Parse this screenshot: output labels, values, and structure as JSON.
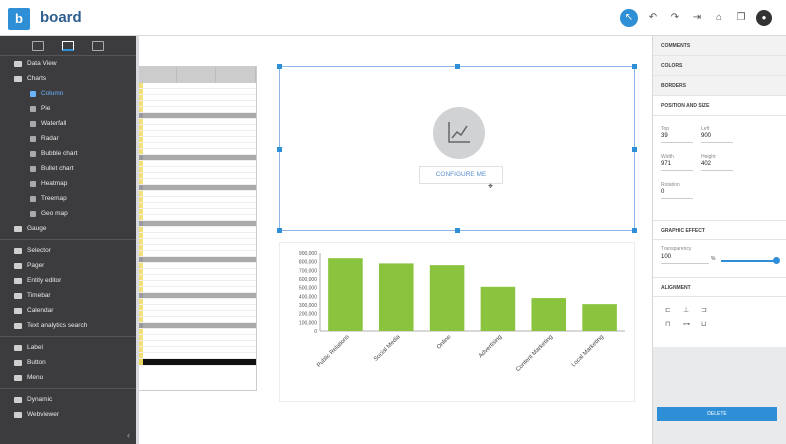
{
  "app": {
    "logo_letter": "b",
    "name": "board"
  },
  "toolbar": {
    "icons": [
      "select-icon",
      "undo-icon",
      "redo-icon",
      "exit-icon",
      "lock-icon",
      "copy-icon",
      "user-avatar-icon"
    ]
  },
  "sidebar": {
    "top_items": [
      {
        "label": "Data View",
        "icon": "dataview-icon"
      },
      {
        "label": "Charts",
        "icon": "chart-icon"
      }
    ],
    "chart_items": [
      {
        "label": "Column",
        "icon": "column-icon",
        "active": true
      },
      {
        "label": "Pie",
        "icon": "pie-icon"
      },
      {
        "label": "Waterfall",
        "icon": "waterfall-icon"
      },
      {
        "label": "Radar",
        "icon": "radar-icon"
      },
      {
        "label": "Bubble chart",
        "icon": "bubble-icon"
      },
      {
        "label": "Bullet chart",
        "icon": "bullet-icon"
      },
      {
        "label": "Heatmap",
        "icon": "heatmap-icon"
      },
      {
        "label": "Treemap",
        "icon": "treemap-icon"
      },
      {
        "label": "Geo map",
        "icon": "geomap-icon"
      }
    ],
    "gauge_item": {
      "label": "Gauge",
      "icon": "gauge-icon"
    },
    "mid_items": [
      {
        "label": "Selector",
        "icon": "selector-icon"
      },
      {
        "label": "Pager",
        "icon": "pager-icon"
      },
      {
        "label": "Entity editor",
        "icon": "entity-editor-icon"
      },
      {
        "label": "Timebar",
        "icon": "timebar-icon"
      },
      {
        "label": "Calendar",
        "icon": "calendar-icon"
      },
      {
        "label": "Text analytics search",
        "icon": "text-analytics-icon"
      }
    ],
    "bottom_items": [
      {
        "label": "Label",
        "icon": "label-icon"
      },
      {
        "label": "Button",
        "icon": "button-icon"
      },
      {
        "label": "Menu",
        "icon": "menu-icon"
      }
    ],
    "last_items": [
      {
        "label": "Dynamic",
        "icon": "dynamic-icon"
      },
      {
        "label": "Webviewer",
        "icon": "webviewer-icon"
      }
    ]
  },
  "configure": {
    "button_label": "CONFIGURE ME"
  },
  "chart_data": {
    "type": "bar",
    "categories": [
      "Public Relations",
      "Social Media",
      "Online",
      "Advertising",
      "Content Marketing",
      "Local Marketing"
    ],
    "values": [
      840000,
      780000,
      760000,
      510000,
      380000,
      310000
    ],
    "title": "",
    "xlabel": "",
    "ylabel": "",
    "ylim": [
      0,
      900000
    ],
    "yticks": [
      0,
      100000,
      200000,
      300000,
      400000,
      500000,
      600000,
      700000,
      800000,
      900000
    ],
    "ytick_labels": [
      "0",
      "100,000",
      "200,000",
      "300,000",
      "400,000",
      "500,000",
      "600,000",
      "700,000",
      "800,000",
      "900,000"
    ],
    "bar_color": "#8ac43f",
    "grid": false,
    "legend": "none"
  },
  "right_panel": {
    "sections": [
      "COMMENTS",
      "COLORS",
      "BORDERS",
      "POSITION AND SIZE"
    ],
    "position": {
      "top_label": "Top",
      "top_value": "39",
      "left_label": "Left",
      "left_value": "900"
    },
    "size": {
      "width_label": "Width",
      "width_value": "971",
      "height_label": "Height",
      "height_value": "402"
    },
    "rotation": {
      "label": "Rotation",
      "value": "0"
    },
    "graphic_effect": {
      "title": "GRAPHIC EFFECT",
      "transparency_label": "Transparency",
      "transparency_value": "100",
      "unit": "%"
    },
    "alignment": {
      "title": "ALIGNMENT"
    },
    "delete_label": "DELETE"
  }
}
